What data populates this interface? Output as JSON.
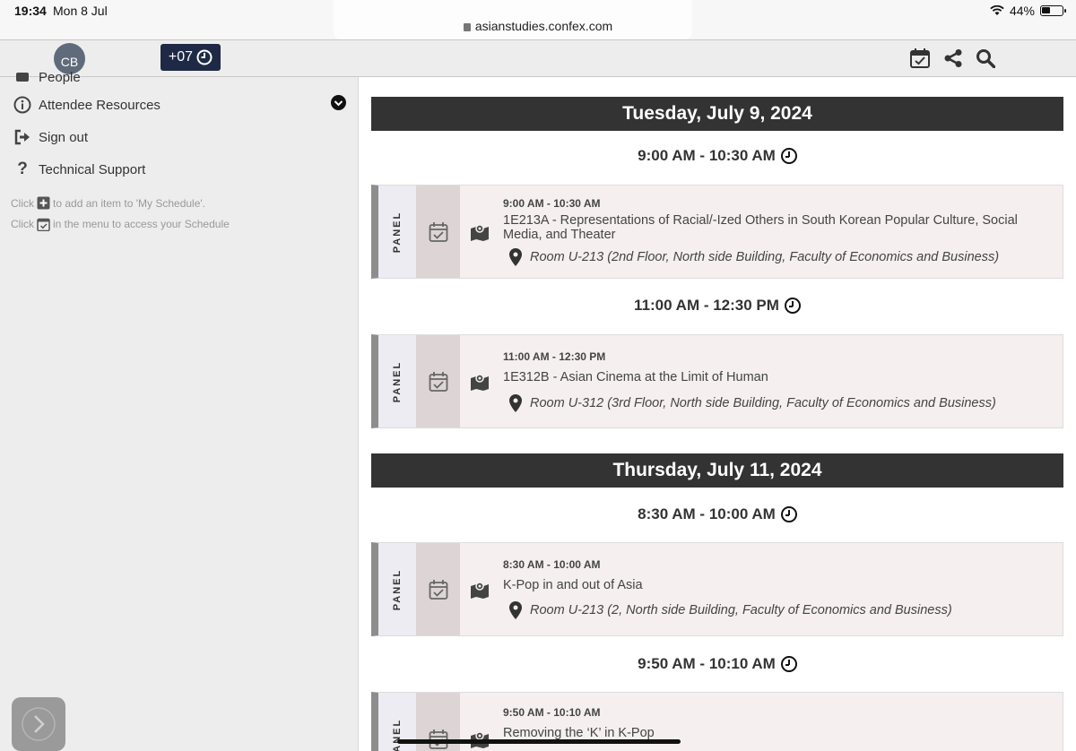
{
  "status_bar": {
    "time": "19:34",
    "date": "Mon 8 Jul",
    "url": "asianstudies.confex.com",
    "battery": "44%",
    "battery_level": 0.44
  },
  "header": {
    "avatar_initials": "CB",
    "timezone_badge": "+07",
    "icons": [
      "calendar-check-icon",
      "share-icon",
      "search-icon"
    ]
  },
  "sidebar": {
    "items": [
      {
        "label": "People",
        "icon": "people-icon"
      },
      {
        "label": "Attendee Resources",
        "icon": "info-icon"
      },
      {
        "label": "Sign out",
        "icon": "sign-out-icon"
      },
      {
        "label": "Technical Support",
        "icon": "question-icon"
      }
    ],
    "hint_add_prefix": "Click",
    "hint_add_suffix": "to add an item to 'My Schedule'.",
    "hint_menu_prefix": "Click",
    "hint_menu_suffix": "in the menu to access your Schedule"
  },
  "schedule": {
    "days": [
      {
        "label": "Tuesday, July 9, 2024"
      },
      {
        "label": "Thursday, July 11, 2024"
      }
    ],
    "slots": [
      "9:00 AM - 10:30 AM",
      "11:00 AM - 12:30 PM",
      "8:30 AM - 10:00 AM",
      "9:50 AM - 10:10 AM"
    ],
    "sessions": [
      {
        "type": "PANEL",
        "time": "9:00 AM - 10:30 AM",
        "title": "1E213A - Representations of Racial/-Ized Others in South Korean Popular Culture, Social Media, and Theater",
        "room": "Room U-213 (2nd Floor, North side Building, Faculty of Economics and Business)"
      },
      {
        "type": "PANEL",
        "time": "11:00 AM - 12:30 PM",
        "title": "1E312B - Asian Cinema at the Limit of Human",
        "room": "Room U-312 (3rd Floor, North side Building, Faculty of Economics and Business)"
      },
      {
        "type": "PANEL",
        "time": "8:30 AM - 10:00 AM",
        "title": "K-Pop in and out of Asia",
        "room": "Room U-213 (2, North side Building, Faculty of Economics and Business)"
      },
      {
        "type": "PANEL",
        "time": "9:50 AM - 10:10 AM",
        "title": "Removing the ‘K’ in K-Pop",
        "room": ""
      }
    ]
  }
}
